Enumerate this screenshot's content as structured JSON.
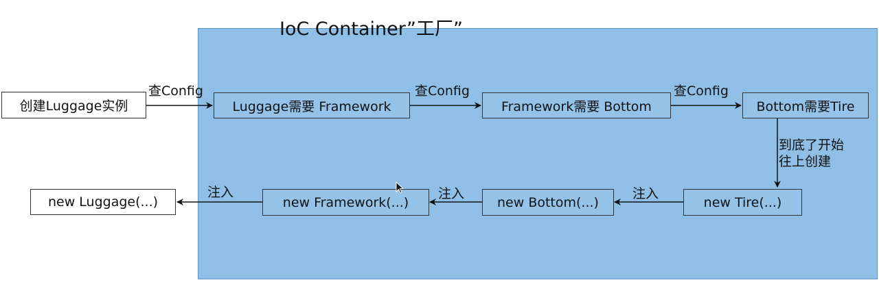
{
  "container": {
    "title": "IoC Container”工厂”"
  },
  "boxes": {
    "create_instance": "创建Luggage实例",
    "luggage_needs": "Luggage需要 Framework",
    "framework_needs": "Framework需要 Bottom",
    "bottom_needs": "Bottom需要Tire",
    "new_tire": "new Tire(...)",
    "new_bottom": "new Bottom(...)",
    "new_framework": "new Framework(...)",
    "new_luggage": "new Luggage(...)"
  },
  "labels": {
    "check_config_1": "查Config",
    "check_config_2": "查Config",
    "check_config_3": "查Config",
    "bottom_reached_line1": "到底了开始",
    "bottom_reached_line2": "往上创建",
    "inject_1": "注入",
    "inject_2": "注入",
    "inject_3": "注入"
  },
  "colors": {
    "container_fill": "#8fbfe6",
    "box_fill": "#ffffff",
    "arrow": "#111111"
  }
}
